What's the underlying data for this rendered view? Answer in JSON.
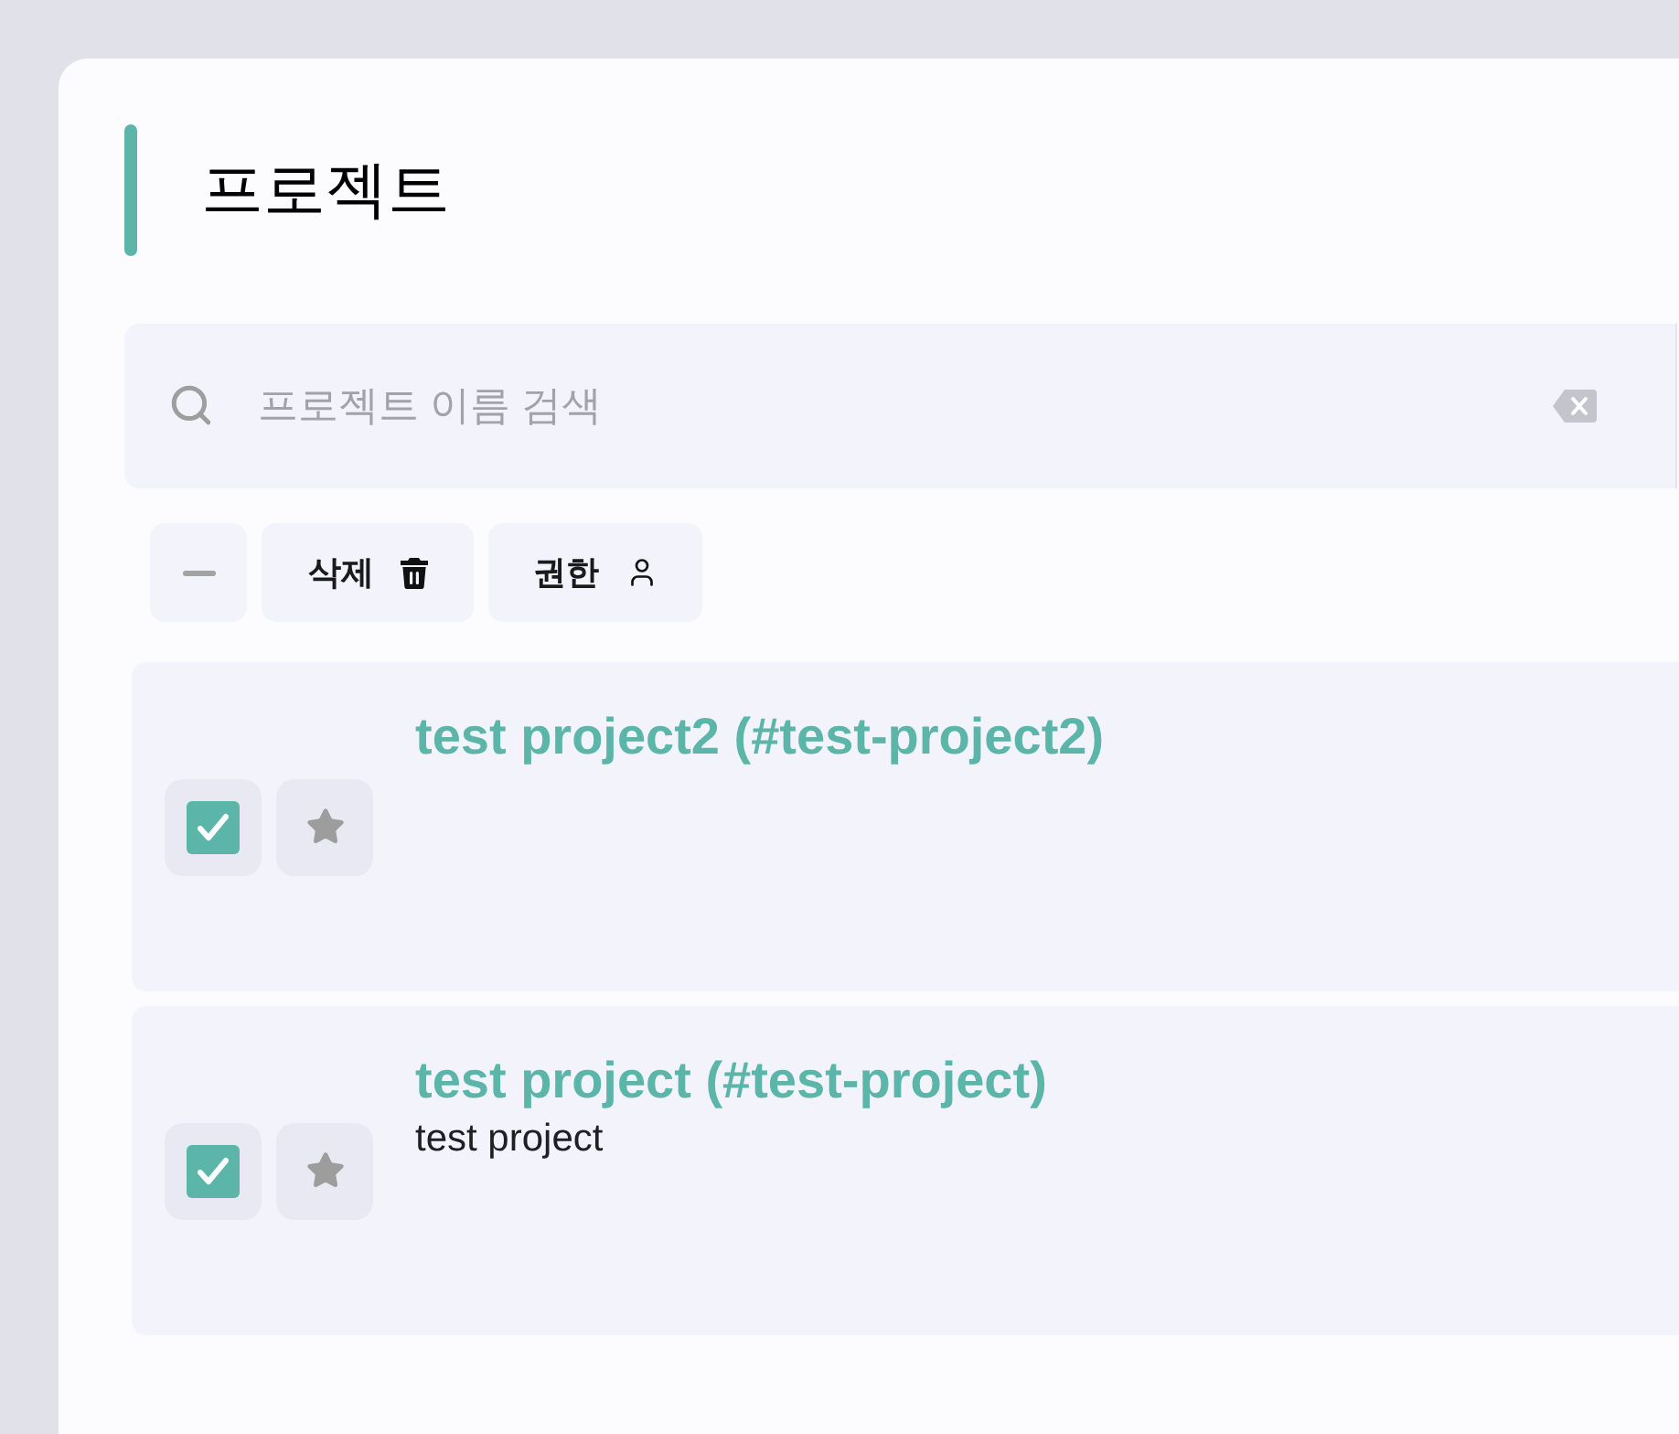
{
  "page": {
    "title": "프로젝트"
  },
  "search": {
    "placeholder": "프로젝트 이름 검색"
  },
  "toolbar": [
    {
      "kind": "deselect"
    },
    {
      "kind": "delete",
      "label": "삭제"
    },
    {
      "kind": "permission",
      "label": "권한"
    }
  ],
  "projects": [
    {
      "title": "test project2 (#test-project2)",
      "checked": true,
      "starred": false
    },
    {
      "title": "test project (#test-project)",
      "description": "test project",
      "checked": true,
      "starred": false
    }
  ]
}
